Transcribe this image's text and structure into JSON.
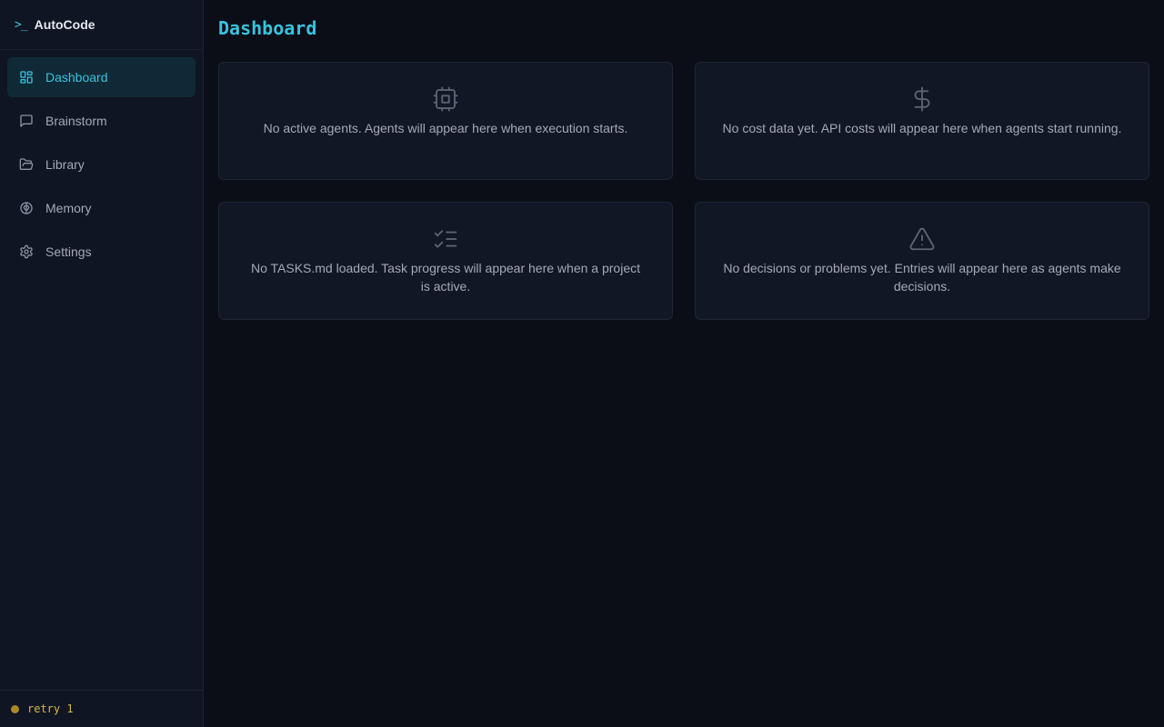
{
  "brand": {
    "prompt": ">_",
    "name": "AutoCode"
  },
  "sidebar": {
    "items": [
      {
        "label": "Dashboard",
        "icon": "layout-grid-icon",
        "active": true
      },
      {
        "label": "Brainstorm",
        "icon": "message-square-icon",
        "active": false
      },
      {
        "label": "Library",
        "icon": "folder-open-icon",
        "active": false
      },
      {
        "label": "Memory",
        "icon": "brain-icon",
        "active": false
      },
      {
        "label": "Settings",
        "icon": "gear-icon",
        "active": false
      }
    ]
  },
  "status": {
    "text": "retry 1",
    "color": "#a8892a"
  },
  "main": {
    "title": "Dashboard",
    "cards": [
      {
        "icon": "cpu-icon",
        "text": "No active agents. Agents will appear here when execution starts."
      },
      {
        "icon": "dollar-sign-icon",
        "text": "No cost data yet. API costs will appear here when agents start running."
      },
      {
        "icon": "list-checks-icon",
        "text": "No TASKS.md loaded. Task progress will appear here when a project is active."
      },
      {
        "icon": "alert-triangle-icon",
        "text": "No decisions or problems yet. Entries will appear here as agents make decisions."
      }
    ]
  },
  "colors": {
    "accent": "#38c2dc",
    "background": "#0b0e17",
    "sidebar": "#0f1522",
    "card": "#111724"
  }
}
